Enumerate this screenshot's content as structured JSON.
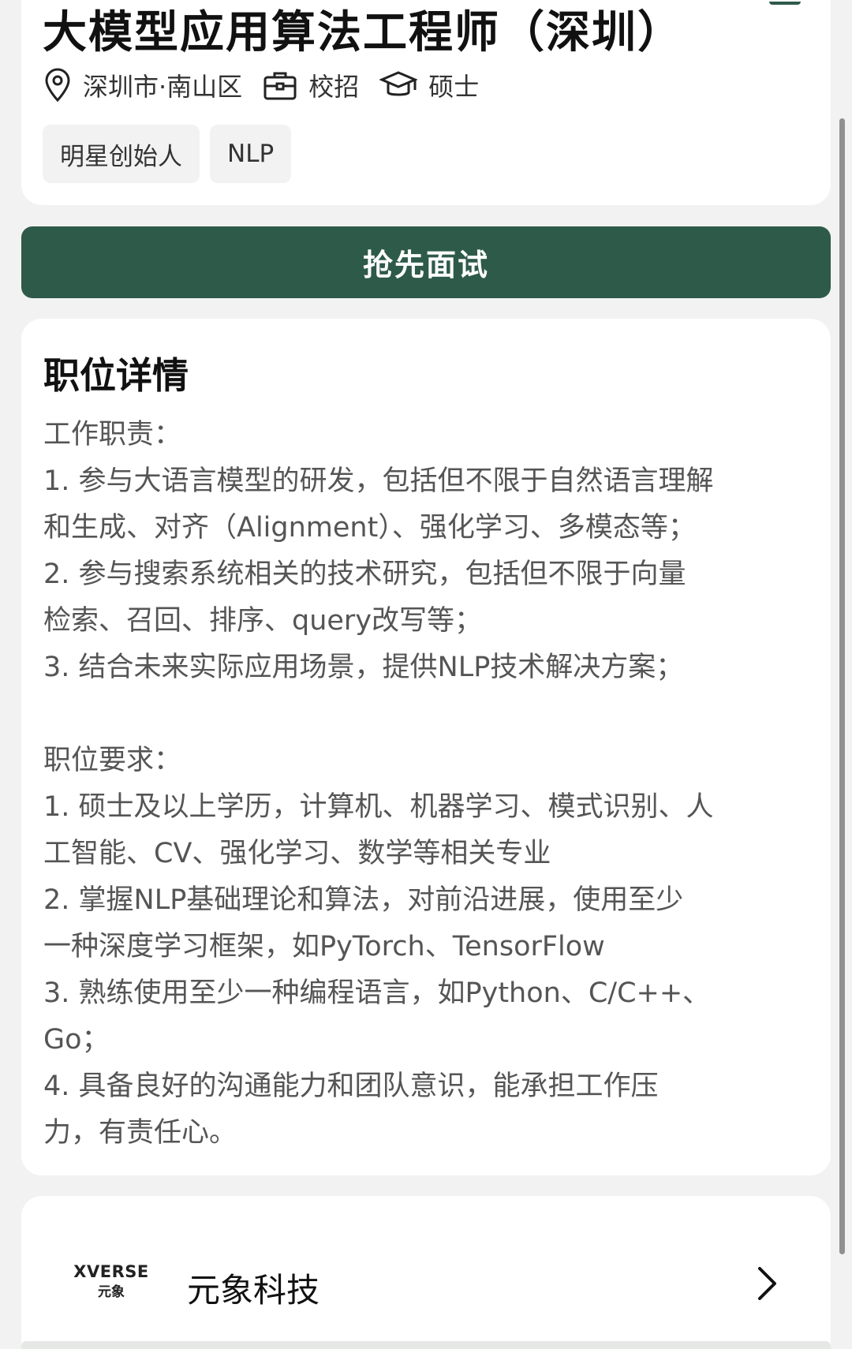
{
  "job": {
    "title": "大模型应用算法工程师（深圳）",
    "location": "深圳市·南山区",
    "type": "校招",
    "degree": "硕士",
    "tags": [
      "明星创始人",
      "NLP"
    ]
  },
  "cta": {
    "label": "抢先面试"
  },
  "details": {
    "title": "职位详情",
    "lines": [
      "工作职责：",
      "1. 参与大语言模型的研发，包括但不限于自然语言理解",
      "和生成、对齐（Alignment）、强化学习、多模态等；",
      "2. 参与搜索系统相关的技术研究，包括但不限于向量",
      "检索、召回、排序、query改写等；",
      "3. 结合未来实际应用场景，提供NLP技术解决方案；",
      "",
      "职位要求：",
      "1. 硕士及以上学历，计算机、机器学习、模式识别、人",
      "工智能、CV、强化学习、数学等相关专业",
      "2. 掌握NLP基础理论和算法，对前沿进展，使用至少",
      "一种深度学习框架，如PyTorch、TensorFlow",
      "3. 熟练使用至少一种编程语言，如Python、C/C++、",
      "Go；",
      "4. 具备良好的沟通能力和团队意识，能承担工作压",
      "力，有责任心。"
    ]
  },
  "company": {
    "name": "元象科技",
    "logo_text": "XVERSE",
    "logo_subtext": "元象"
  },
  "colors": {
    "primary": "#2e5a4a",
    "background": "#f2f2f2",
    "card": "#ffffff",
    "logo_accent": "#6b3bc8"
  },
  "icons": {
    "location": "location-pin-icon",
    "job_type": "briefcase-icon",
    "degree": "graduation-cap-icon",
    "company_nav": "chevron-right-icon"
  }
}
